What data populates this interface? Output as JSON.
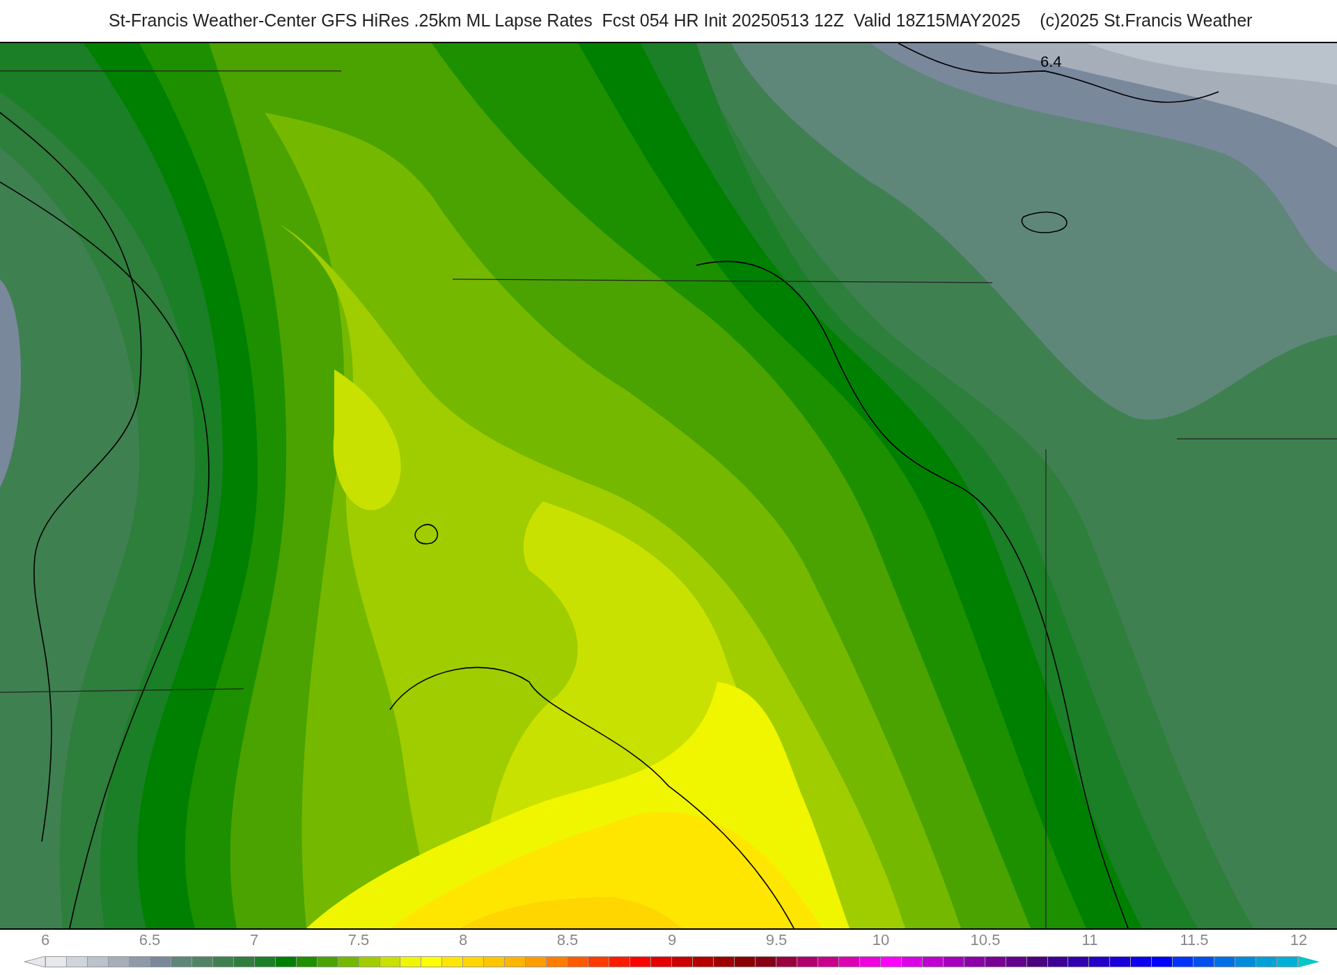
{
  "title": "St-Francis Weather-Center GFS HiRes .25km ML Lapse Rates  Fcst 054 HR Init 20250513 12Z  Valid 18Z15MAY2025    (c)2025 St.Francis Weather",
  "map": {
    "contour_labels": [
      "6.4"
    ]
  },
  "legend": {
    "ticks": [
      "6",
      "6.5",
      "7",
      "7.5",
      "8",
      "8.5",
      "9",
      "9.5",
      "10",
      "10.5",
      "11",
      "11.5",
      "12"
    ],
    "end_arrows": [
      {
        "color": "#e6e8ec"
      },
      {
        "color": "#00c8c8"
      }
    ],
    "swatches": [
      {
        "color": "#e6e8ec"
      },
      {
        "color": "#d0d5dc"
      },
      {
        "color": "#bac2cb"
      },
      {
        "color": "#a5aeb9"
      },
      {
        "color": "#8e9aa8"
      },
      {
        "color": "#7a889c"
      },
      {
        "color": "#5e877a"
      },
      {
        "color": "#4f8565"
      },
      {
        "color": "#3f8051"
      },
      {
        "color": "#2e7e3c"
      },
      {
        "color": "#1a7f26"
      },
      {
        "color": "#008000"
      },
      {
        "color": "#1d9000"
      },
      {
        "color": "#4aa300"
      },
      {
        "color": "#74b800"
      },
      {
        "color": "#a0cd00"
      },
      {
        "color": "#c8e100"
      },
      {
        "color": "#f0f500"
      },
      {
        "color": "#ffff00"
      },
      {
        "color": "#ffe600"
      },
      {
        "color": "#ffd600"
      },
      {
        "color": "#ffc600"
      },
      {
        "color": "#ffb400"
      },
      {
        "color": "#ff9c00"
      },
      {
        "color": "#ff7c00"
      },
      {
        "color": "#ff5a00"
      },
      {
        "color": "#ff3a00"
      },
      {
        "color": "#ff1a00"
      },
      {
        "color": "#ff0000"
      },
      {
        "color": "#e20000"
      },
      {
        "color": "#cc0000"
      },
      {
        "color": "#b50000"
      },
      {
        "color": "#9e0000"
      },
      {
        "color": "#880000"
      },
      {
        "color": "#870014"
      },
      {
        "color": "#9c003c"
      },
      {
        "color": "#b0006e"
      },
      {
        "color": "#c8008c"
      },
      {
        "color": "#dc00b4"
      },
      {
        "color": "#f000dc"
      },
      {
        "color": "#ff00ff"
      },
      {
        "color": "#dc00e6"
      },
      {
        "color": "#c000d0"
      },
      {
        "color": "#a400be"
      },
      {
        "color": "#8c00aa"
      },
      {
        "color": "#780096"
      },
      {
        "color": "#640090"
      },
      {
        "color": "#4a0080"
      },
      {
        "color": "#3c0096"
      },
      {
        "color": "#3000b0"
      },
      {
        "color": "#2400c8"
      },
      {
        "color": "#1800dc"
      },
      {
        "color": "#0c00f0"
      },
      {
        "color": "#0000ff"
      },
      {
        "color": "#0033ff"
      },
      {
        "color": "#0050f0"
      },
      {
        "color": "#0070e6"
      },
      {
        "color": "#008cdc"
      },
      {
        "color": "#00a0d8"
      },
      {
        "color": "#00b0d8"
      }
    ]
  }
}
